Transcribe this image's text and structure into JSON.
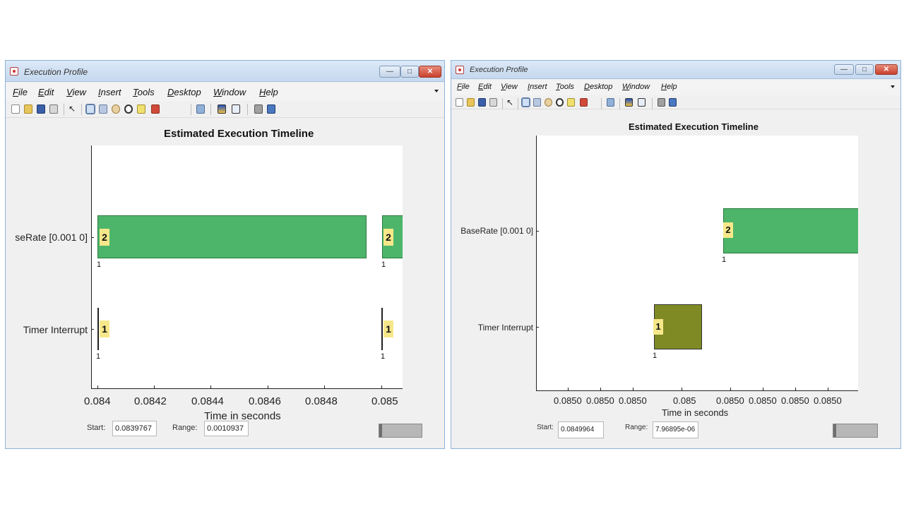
{
  "left_window": {
    "title": "Execution Profile",
    "menu": [
      "File",
      "Edit",
      "View",
      "Insert",
      "Tools",
      "Desktop",
      "Window",
      "Help"
    ],
    "toolbar_icons": [
      "new-file-icon",
      "open-folder-icon",
      "save-icon",
      "print-icon",
      "pointer-icon",
      "zoom-in-icon",
      "zoom-out-icon",
      "pan-icon",
      "rotate-icon",
      "data-cursor-icon",
      "brush-icon",
      "link-icon",
      "colorbar-icon",
      "legend-icon",
      "hide-plot-icon",
      "show-plot-icon"
    ],
    "chart_title": "Estimated Execution Timeline",
    "xlabel": "Time in seconds",
    "row_labels": [
      "seRate [0.001 0]",
      "Timer Interrupt"
    ],
    "x_ticks": [
      "0.084",
      "0.0842",
      "0.0844",
      "0.0846",
      "0.0848",
      "0.085"
    ],
    "start_label": "Start:",
    "start_value": "0.0839767",
    "range_label": "Range:",
    "range_value": "0.0010937",
    "bar_tags": {
      "base": "2",
      "timer": "1",
      "marker": "1"
    }
  },
  "right_window": {
    "title": "Execution Profile",
    "menu": [
      "File",
      "Edit",
      "View",
      "Insert",
      "Tools",
      "Desktop",
      "Window",
      "Help"
    ],
    "toolbar_icons": [
      "new-file-icon",
      "open-folder-icon",
      "save-icon",
      "print-icon",
      "pointer-icon",
      "zoom-in-icon",
      "zoom-out-icon",
      "pan-icon",
      "rotate-icon",
      "data-cursor-icon",
      "brush-icon",
      "link-icon",
      "colorbar-icon",
      "legend-icon",
      "hide-plot-icon",
      "show-plot-icon"
    ],
    "chart_title": "Estimated Execution Timeline",
    "xlabel": "Time in seconds",
    "row_labels": [
      "BaseRate [0.001 0]",
      "Timer Interrupt"
    ],
    "x_ticks": [
      "0.0850",
      "0.0850",
      "0.0850",
      "0.085",
      "0.0850",
      "0.0850",
      "0.0850",
      "0.0850"
    ],
    "start_label": "Start:",
    "start_value": "0.0849964",
    "range_label": "Range:",
    "range_value": "7.96895e-06",
    "bar_tags": {
      "base": "2",
      "timer": "1",
      "marker": "1"
    }
  },
  "colors": {
    "base_rate_bar": "#4db56a",
    "timer_interrupt_bar": "#7f8a25",
    "task_tag": "#f6e88a"
  },
  "chart_data": [
    {
      "type": "bar",
      "title": "Estimated Execution Timeline",
      "xlabel": "Time in seconds",
      "ylabel": "",
      "xlim": [
        0.084,
        0.0851
      ],
      "categories": [
        "seRate [0.001 0]",
        "Timer Interrupt"
      ],
      "tasks": [
        {
          "category": "seRate [0.001 0]",
          "start": 0.084,
          "end": 0.08494,
          "label": "2"
        },
        {
          "category": "seRate [0.001 0]",
          "start": 0.085,
          "end": 0.0851,
          "label": "2"
        },
        {
          "category": "Timer Interrupt",
          "start": 0.084,
          "end": 0.084,
          "label": "1"
        },
        {
          "category": "Timer Interrupt",
          "start": 0.085,
          "end": 0.085,
          "label": "1"
        }
      ]
    },
    {
      "type": "bar",
      "title": "Estimated Execution Timeline",
      "xlabel": "Time in seconds",
      "ylabel": "",
      "categories": [
        "BaseRate [0.001 0]",
        "Timer Interrupt"
      ],
      "tasks": [
        {
          "category": "BaseRate [0.001 0]",
          "start_fraction": 0.58,
          "end_fraction": 1.0,
          "label": "2"
        },
        {
          "category": "Timer Interrupt",
          "start_fraction": 0.37,
          "end_fraction": 0.51,
          "label": "1"
        }
      ]
    }
  ]
}
